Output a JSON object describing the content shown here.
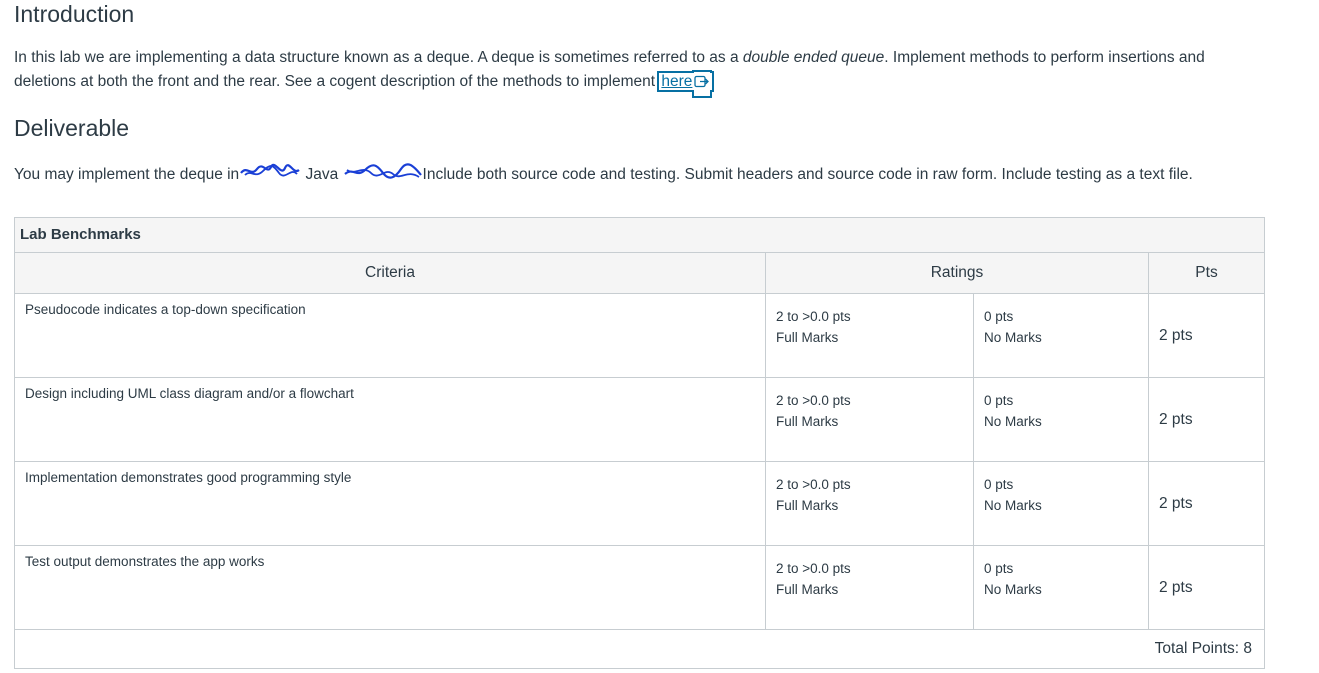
{
  "introduction": {
    "heading": "Introduction",
    "text_1": "In this lab we are implementing a data structure known as a deque. A deque is sometimes referred to as a ",
    "emphasis": "double ended queue",
    "text_2": ". Implement methods to perform insertions and deletions at both the front and the rear. See a cogent description of the methods to implement ",
    "link_label": "here"
  },
  "deliverable": {
    "heading": "Deliverable",
    "text_1": "You may implement the deque in",
    "text_2": " Java ",
    "text_3": "Include both source code and testing. Submit headers and source code in raw form. Include testing as a text file."
  },
  "rubric": {
    "title": "Lab Benchmarks",
    "headers": {
      "criteria": "Criteria",
      "ratings": "Ratings",
      "pts": "Pts"
    },
    "rows": [
      {
        "criterion": "Pseudocode indicates a top-down specification",
        "rating1_pts": "2 to >0.0 pts",
        "rating1_label": "Full Marks",
        "rating2_pts": "0 pts",
        "rating2_label": "No Marks",
        "pts": "2 pts"
      },
      {
        "criterion": "Design including UML class diagram and/or a flowchart",
        "rating1_pts": "2 to >0.0 pts",
        "rating1_label": "Full Marks",
        "rating2_pts": "0 pts",
        "rating2_label": "No Marks",
        "pts": "2 pts"
      },
      {
        "criterion": "Implementation demonstrates good programming style",
        "rating1_pts": "2 to >0.0 pts",
        "rating1_label": "Full Marks",
        "rating2_pts": "0 pts",
        "rating2_label": "No Marks",
        "pts": "2 pts"
      },
      {
        "criterion": "Test output demonstrates the app works",
        "rating1_pts": "2 to >0.0 pts",
        "rating1_label": "Full Marks",
        "rating2_pts": "0 pts",
        "rating2_label": "No Marks",
        "pts": "2 pts"
      }
    ],
    "total": "Total Points: 8"
  },
  "colors": {
    "text": "#2d3b45",
    "link": "#0770a3",
    "border": "#c7cdd1",
    "header_bg": "#f5f5f5",
    "scribble": "#1a3fd6"
  },
  "icons": {
    "external_link": "external-link-icon",
    "redaction": "scribble-redaction"
  }
}
